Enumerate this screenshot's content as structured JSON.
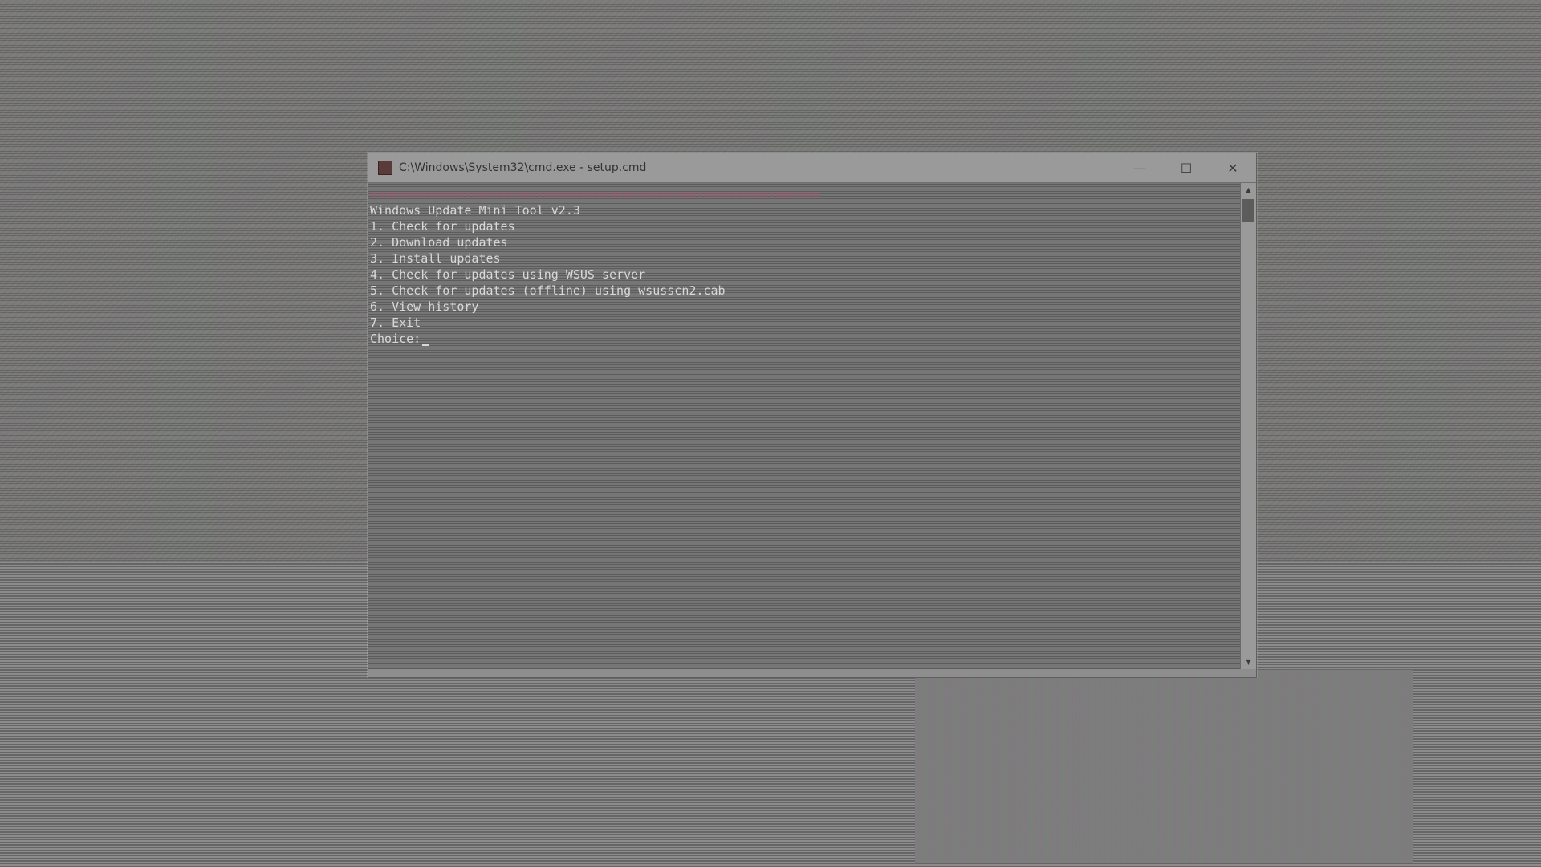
{
  "window": {
    "title": "C:\\Windows\\System32\\cmd.exe - setup.cmd",
    "controls": {
      "minimize": "—",
      "maximize": "☐",
      "close": "✕"
    }
  },
  "console": {
    "separator": "==============================================================",
    "header": "Windows Update Mini Tool v2.3",
    "menu": [
      "1. Check for updates",
      "2. Download updates",
      "3. Install updates",
      "4. Check for updates using WSUS server",
      "5. Check for updates (offline) using wsusscn2.cab",
      "6. View history",
      "7. Exit"
    ],
    "prompt": "Choice:"
  },
  "scrollbar": {
    "up_arrow": "▲",
    "down_arrow": "▼"
  }
}
